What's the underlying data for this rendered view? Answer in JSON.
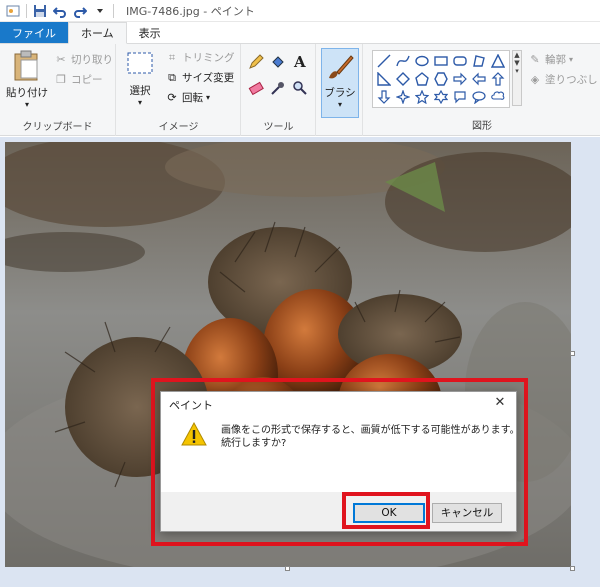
{
  "window": {
    "title": "IMG-7486.jpg - ペイント"
  },
  "tabs": [
    {
      "label": "ファイル"
    },
    {
      "label": "ホーム"
    },
    {
      "label": "表示"
    }
  ],
  "clipboard": {
    "paste_label": "貼り付け",
    "cut_label": "切り取り",
    "copy_label": "コピー",
    "group_label": "クリップボード"
  },
  "image": {
    "select_label": "選択",
    "crop_label": "トリミング",
    "resize_label": "サイズ変更",
    "rotate_label": "回転",
    "group_label": "イメージ"
  },
  "tools": {
    "group_label": "ツール",
    "text_tool_glyph": "A"
  },
  "brushes": {
    "label": "ブラシ"
  },
  "shapes": {
    "group_label": "図形",
    "outline_label": "輪郭",
    "fill_label": "塗りつぶし"
  },
  "dialog": {
    "title": "ペイント",
    "message_line1": "画像をこの形式で保存すると、画質が低下する可能性があります。",
    "message_line2": "続行しますか?",
    "ok_label": "OK",
    "cancel_label": "キャンセル",
    "highlight_color": "#e0141e"
  },
  "colors": {
    "accent": "#1979ca",
    "workspace": "#dbe4f2",
    "ribbon": "#f5f6f7"
  }
}
